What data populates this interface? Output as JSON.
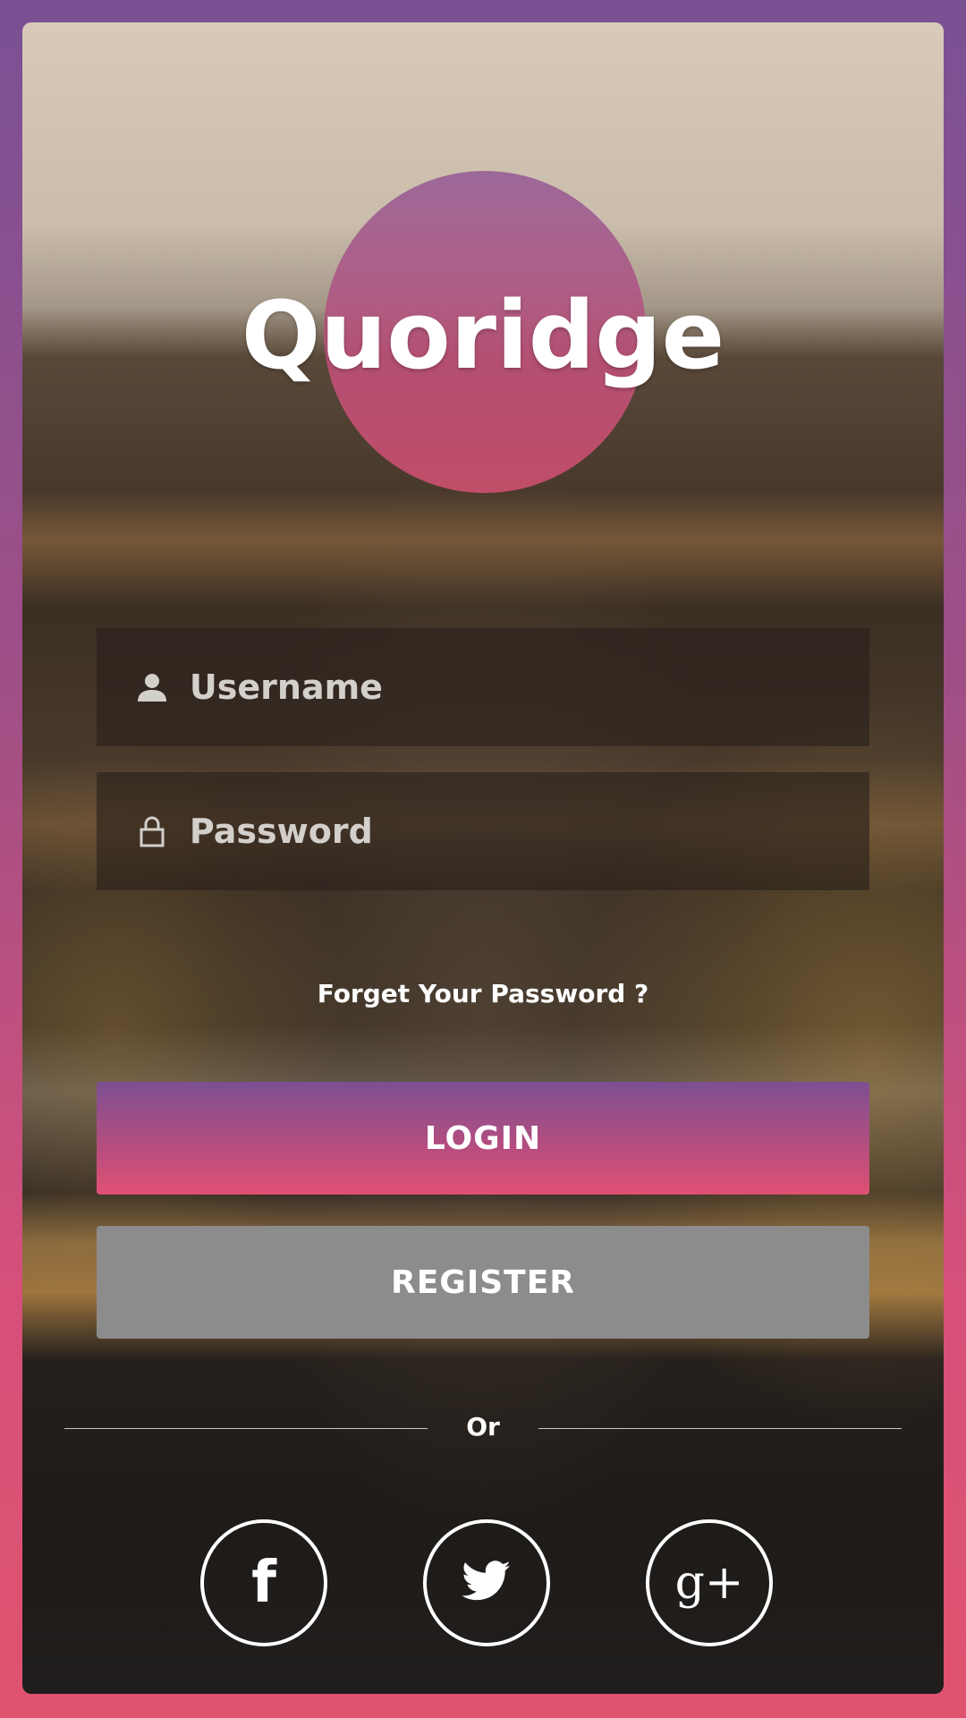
{
  "brand": {
    "name": "Quoridge"
  },
  "login_form": {
    "username_placeholder": "Username",
    "username_value": "",
    "password_placeholder": "Password",
    "password_value": "",
    "forgot_password_label": "Forget Your Password ?",
    "login_label": "LOGIN",
    "register_label": "REGISTER",
    "divider_text": "Or"
  },
  "social": {
    "facebook_glyph": "f",
    "google_plus_glyph": "g+",
    "icons": [
      "facebook-icon",
      "twitter-icon",
      "google-plus-icon"
    ]
  },
  "colors": {
    "gradient_top": "#7a5195",
    "gradient_bottom": "#e0536f",
    "register_button": "#8c8c8c"
  }
}
